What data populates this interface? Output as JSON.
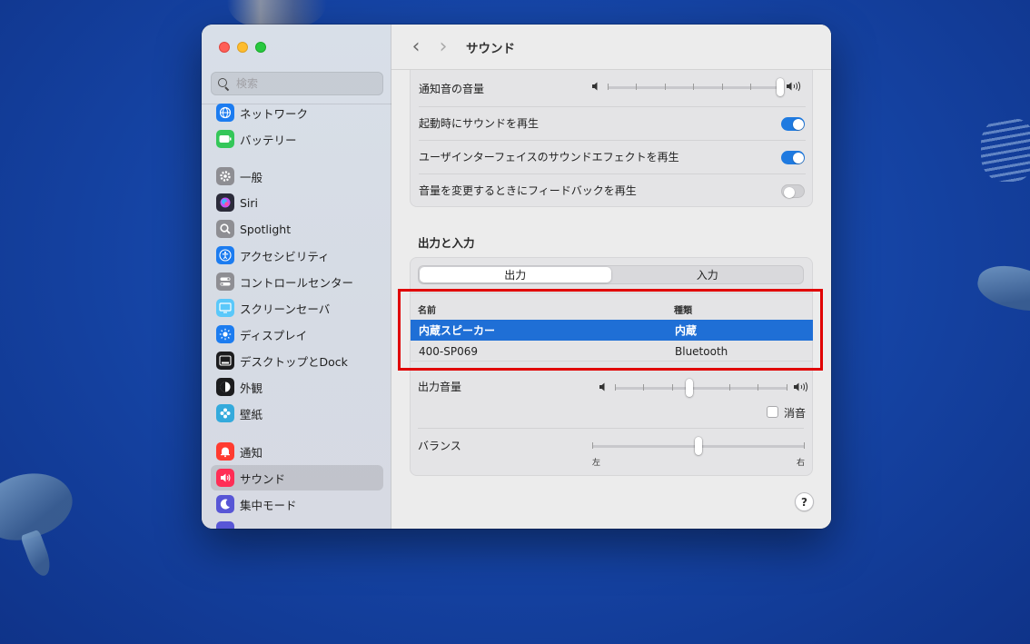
{
  "window": {
    "title": "サウンド"
  },
  "sidebar": {
    "search_placeholder": "検索",
    "items": [
      {
        "label": "ネットワーク",
        "icon": "globe-icon",
        "color": "#1c7cf0"
      },
      {
        "label": "バッテリー",
        "icon": "battery-icon",
        "color": "#34c759"
      },
      {
        "label": "一般",
        "icon": "gear-icon",
        "color": "#8e8e93"
      },
      {
        "label": "Siri",
        "icon": "siri-icon",
        "color": "#2b2b3a"
      },
      {
        "label": "Spotlight",
        "icon": "magnifier-icon",
        "color": "#8e8e93"
      },
      {
        "label": "アクセシビリティ",
        "icon": "accessibility-icon",
        "color": "#1c7cf0"
      },
      {
        "label": "コントロールセンター",
        "icon": "control-center-icon",
        "color": "#8e8e93"
      },
      {
        "label": "スクリーンセーバ",
        "icon": "screensaver-icon",
        "color": "#5ac8fa"
      },
      {
        "label": "ディスプレイ",
        "icon": "sun-icon",
        "color": "#1c7cf0"
      },
      {
        "label": "デスクトップとDock",
        "icon": "dock-icon",
        "color": "#1c1c1e"
      },
      {
        "label": "外観",
        "icon": "appearance-icon",
        "color": "#1c1c1e"
      },
      {
        "label": "壁紙",
        "icon": "wallpaper-icon",
        "color": "#34aadc"
      },
      {
        "label": "通知",
        "icon": "bell-icon",
        "color": "#ff3b30"
      },
      {
        "label": "サウンド",
        "icon": "speaker-icon",
        "color": "#ff2d55",
        "selected": true
      },
      {
        "label": "集中モード",
        "icon": "moon-icon",
        "color": "#5856d6"
      }
    ]
  },
  "settings": {
    "alert_volume_label": "通知音の音量",
    "alert_volume": 1.0,
    "startup_sound_label": "起動時にサウンドを再生",
    "startup_sound": true,
    "ui_sound_effects_label": "ユーザインターフェイスのサウンドエフェクトを再生",
    "ui_sound_effects": true,
    "volume_feedback_label": "音量を変更するときにフィードバックを再生",
    "volume_feedback": false
  },
  "output_input": {
    "heading": "出力と入力",
    "tabs": [
      {
        "label": "出力",
        "active": true
      },
      {
        "label": "入力",
        "active": false
      }
    ],
    "columns": {
      "name": "名前",
      "type": "種類"
    },
    "devices": [
      {
        "name": "内蔵スピーカー",
        "type": "内蔵",
        "selected": true
      },
      {
        "name": "400-SP069",
        "type": "Bluetooth",
        "selected": false
      }
    ],
    "output_volume_label": "出力音量",
    "output_volume": 0.43,
    "mute_label": "消音",
    "mute": false,
    "balance_label": "バランス",
    "balance": 0.5,
    "balance_left": "左",
    "balance_right": "右"
  },
  "help_label": "?",
  "colors": {
    "accent": "#1f6fd6",
    "highlight_box": "#e00000"
  }
}
